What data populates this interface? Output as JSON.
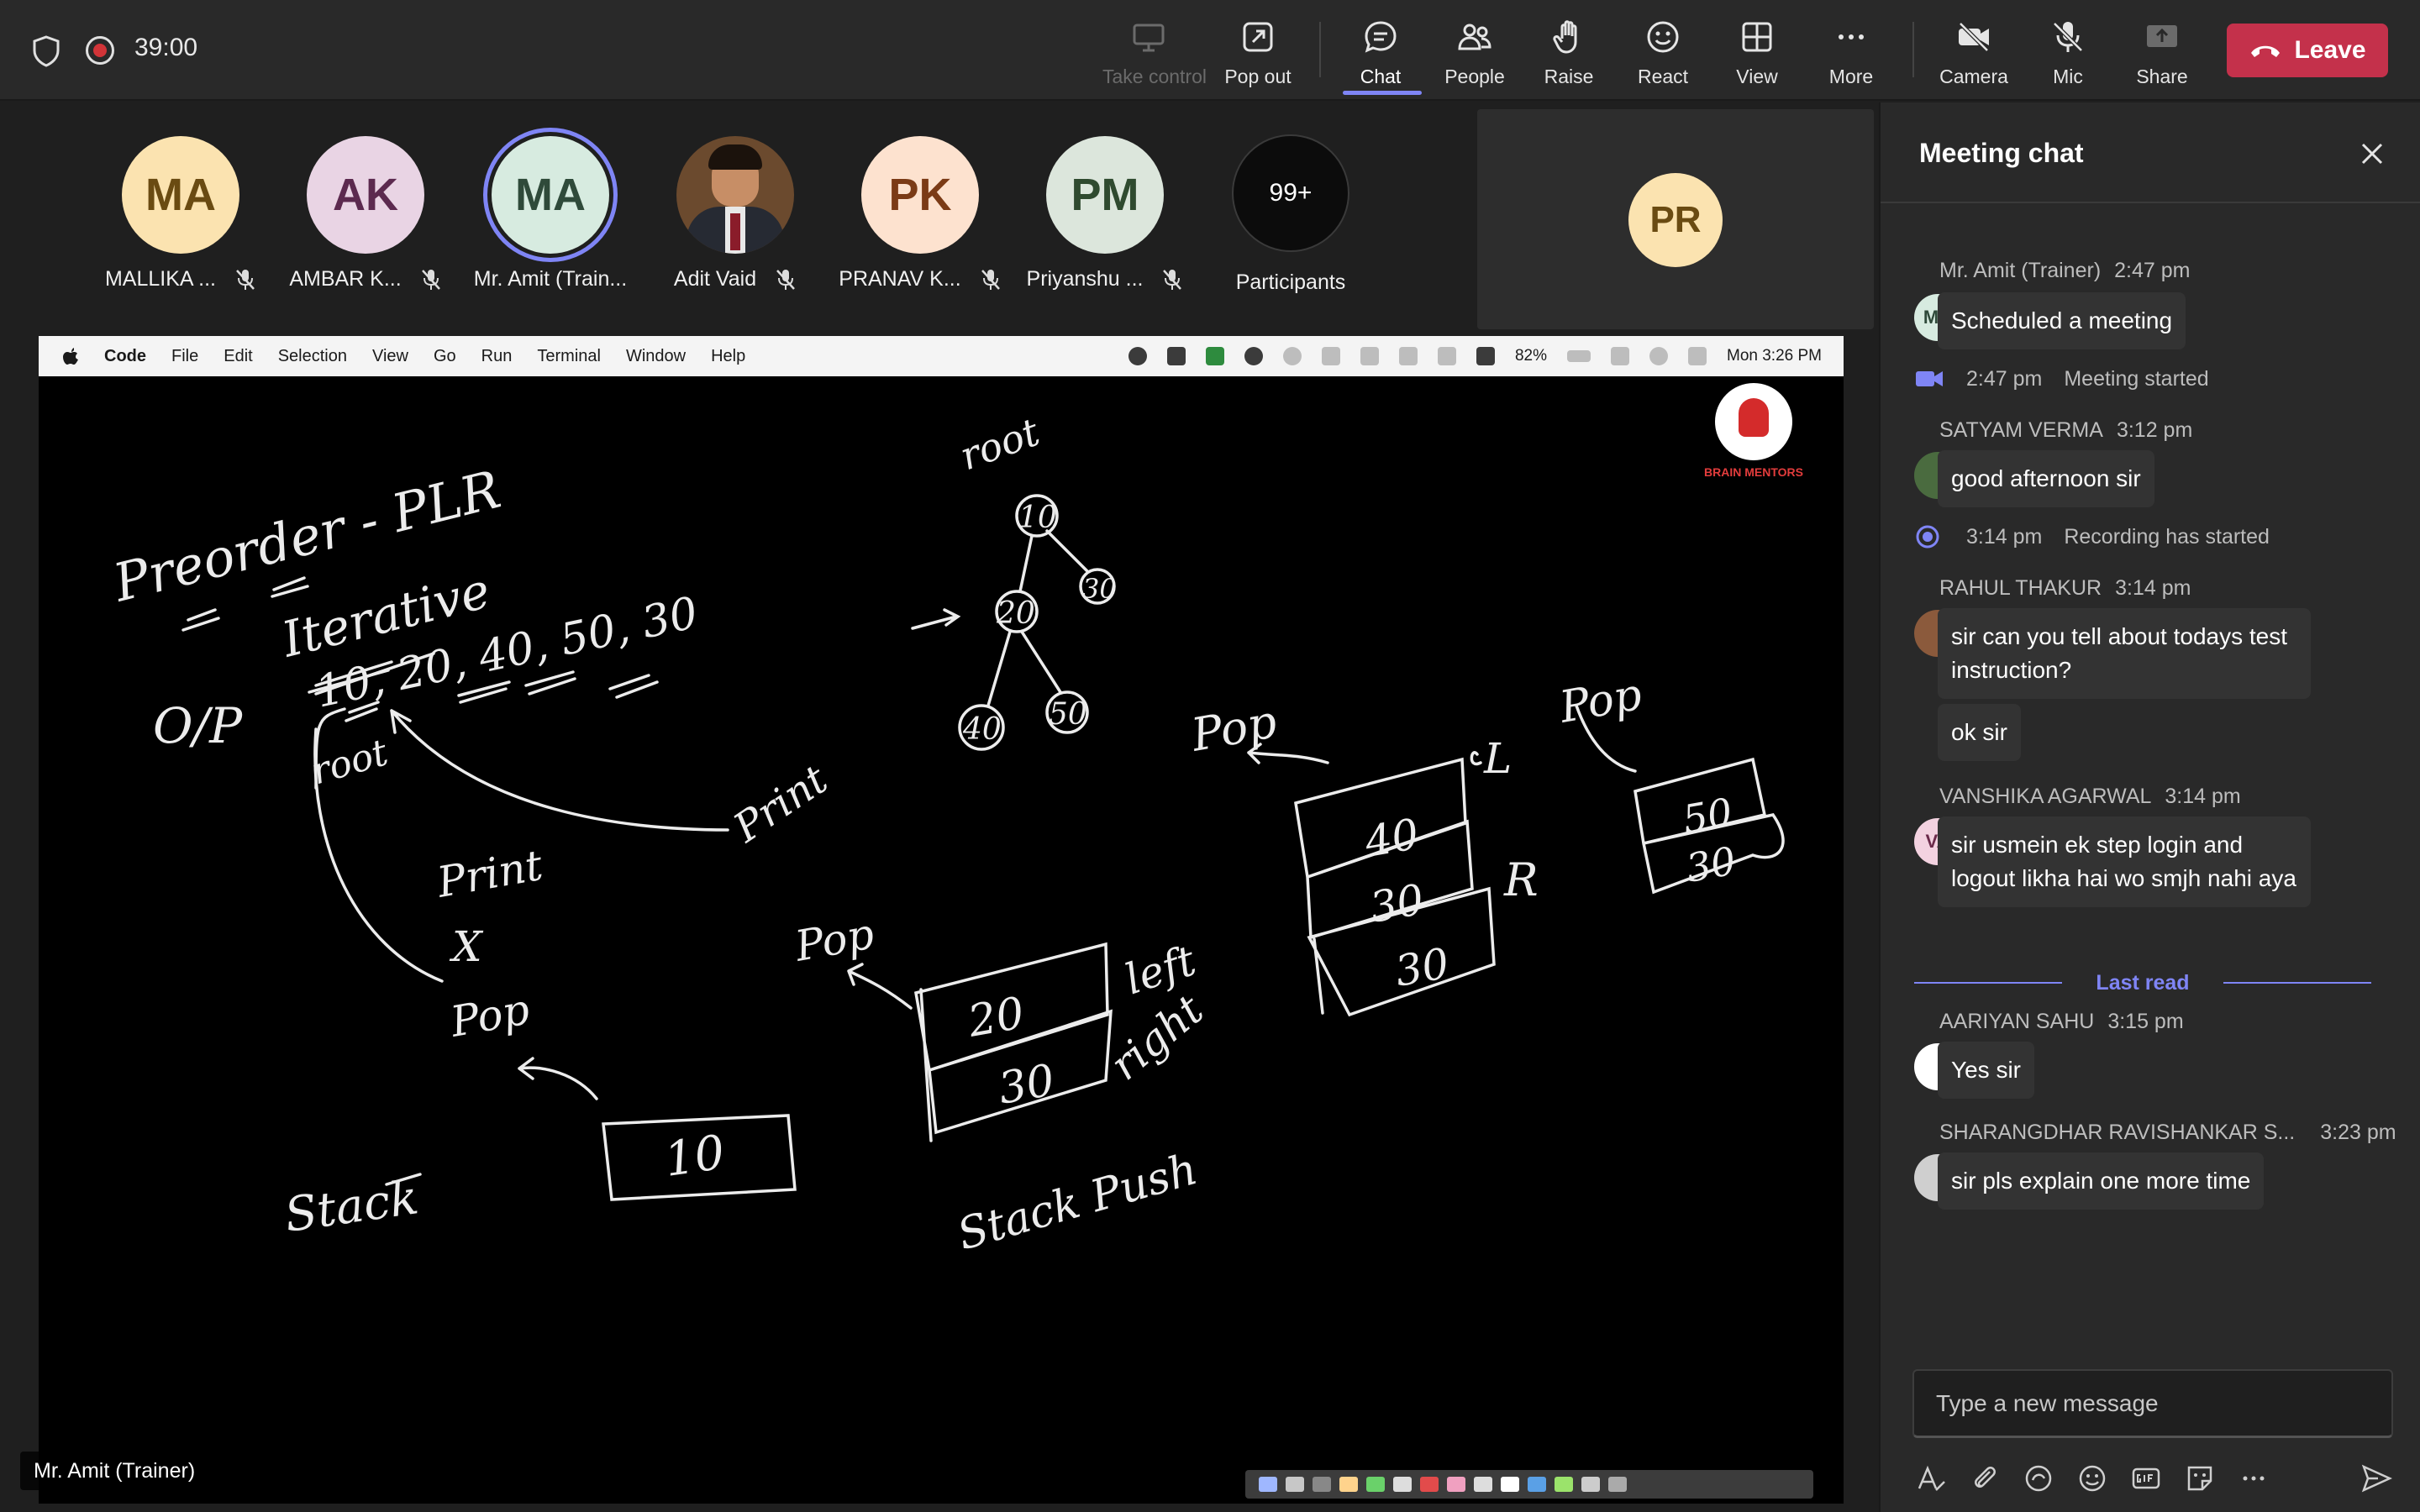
{
  "topbar": {
    "timer": "39:00",
    "buttons": {
      "take_control": "Take control",
      "pop_out": "Pop out",
      "chat": "Chat",
      "people": "People",
      "raise": "Raise",
      "react": "React",
      "view": "View",
      "more": "More",
      "camera": "Camera",
      "mic": "Mic",
      "share": "Share"
    },
    "leave": "Leave",
    "leave_color": "#c4314b",
    "accent": "#7f85f5"
  },
  "participants": [
    {
      "initials": "MA",
      "name": "MALLIKA ...",
      "bg": "#fbe3b0",
      "fg": "#6a4b12",
      "muted": true
    },
    {
      "initials": "AK",
      "name": "AMBAR K...",
      "bg": "#e9d4e4",
      "fg": "#5c2a4f",
      "muted": true
    },
    {
      "initials": "MA",
      "name": "Mr. Amit (Train...",
      "bg": "#d7ebe0",
      "fg": "#2f4a3a",
      "muted": false,
      "speaking": true
    },
    {
      "initials": "",
      "name": "Adit Vaid",
      "photo": true,
      "muted": true
    },
    {
      "initials": "PK",
      "name": "PRANAV K...",
      "bg": "#fde2cf",
      "fg": "#7b3b16",
      "muted": true
    },
    {
      "initials": "PM",
      "name": "Priyanshu ...",
      "bg": "#dce6dc",
      "fg": "#2f4a2f",
      "muted": true
    }
  ],
  "more_participants": {
    "count": "99+",
    "label": "Participants"
  },
  "self_tile": {
    "initials": "PR"
  },
  "shared_screen": {
    "menubar": {
      "app": "Code",
      "menus": [
        "File",
        "Edit",
        "Selection",
        "View",
        "Go",
        "Run",
        "Terminal",
        "Window",
        "Help"
      ],
      "battery": "82%",
      "clock": "Mon 3:26 PM"
    },
    "logo_text": "BRAIN MENTORS",
    "whiteboard_text": {
      "preorder": "Preorder - PLR",
      "iterative": "Iterative",
      "op": "O/P",
      "sequence": "10, 20, 40, 50, 30",
      "root_lbl": "root",
      "tree_root": "root",
      "print1": "Print",
      "x1": "X",
      "pop1": "Pop",
      "print2": "Print",
      "pop2": "Pop",
      "stack_lbl": "Stack",
      "stack_push": "Stack Push",
      "left": "left",
      "right": "right",
      "pop3": "Pop",
      "l": "L",
      "r": "R",
      "pop4": "Pop",
      "n10": "10",
      "n20": "20",
      "n30": "30",
      "n40": "40",
      "n50": "50",
      "s10": "10",
      "s20": "20",
      "s30": "30",
      "s40": "40",
      "s30b": "30",
      "s30c": "30",
      "s50": "50",
      "s30d": "30"
    },
    "presenter": "Mr. Amit (Trainer)"
  },
  "chat": {
    "title": "Meeting chat",
    "messages": [
      {
        "author": "Mr. Amit (Trainer)",
        "time": "2:47 pm",
        "text": "Scheduled a meeting",
        "avatar": "MA"
      },
      {
        "system": "Meeting started",
        "time": "2:47 pm"
      },
      {
        "author": "SATYAM VERMA",
        "time": "3:12 pm",
        "text": "good afternoon sir"
      },
      {
        "system": "Recording has started",
        "time": "3:14 pm"
      },
      {
        "author": "RAHUL THAKUR",
        "time": "3:14 pm",
        "text": "sir can you tell about todays test instruction?",
        "text2": "ok sir"
      },
      {
        "author": "VANSHIKA AGARWAL",
        "time": "3:14 pm",
        "text": "sir usmein ek step login and logout likha hai wo smjh nahi aya",
        "avatar": "VA"
      },
      {
        "author": "AARIYAN SAHU",
        "time": "3:15 pm",
        "text": "Yes sir"
      },
      {
        "author": "SHARANGDHAR RAVISHANKAR S...",
        "time": "3:23 pm",
        "text": "sir pls explain one more time"
      }
    ],
    "last_read": "Last read",
    "compose_placeholder": "Type a new message"
  }
}
